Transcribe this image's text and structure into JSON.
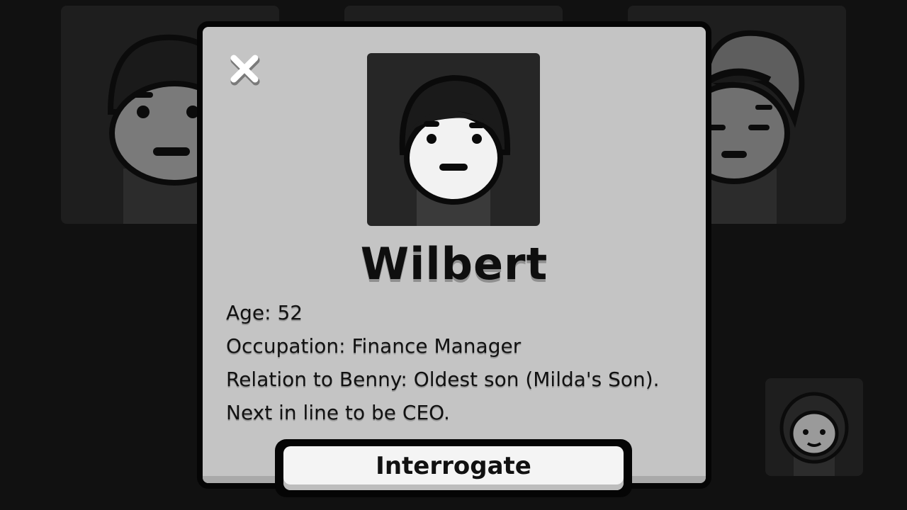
{
  "profile": {
    "name": "Wilbert",
    "age_line": "Age: 52",
    "occupation_line": "Occupation: Finance Manager",
    "relation_line": "Relation to Benny: Oldest son (Milda's Son). Next in line to be CEO."
  },
  "actions": {
    "interrogate_label": "Interrogate",
    "close_icon": "close-x-icon"
  },
  "colors": {
    "background": "#111111",
    "modal": "#c4c4c4",
    "button": "#f4f4f4",
    "border": "#050505"
  }
}
